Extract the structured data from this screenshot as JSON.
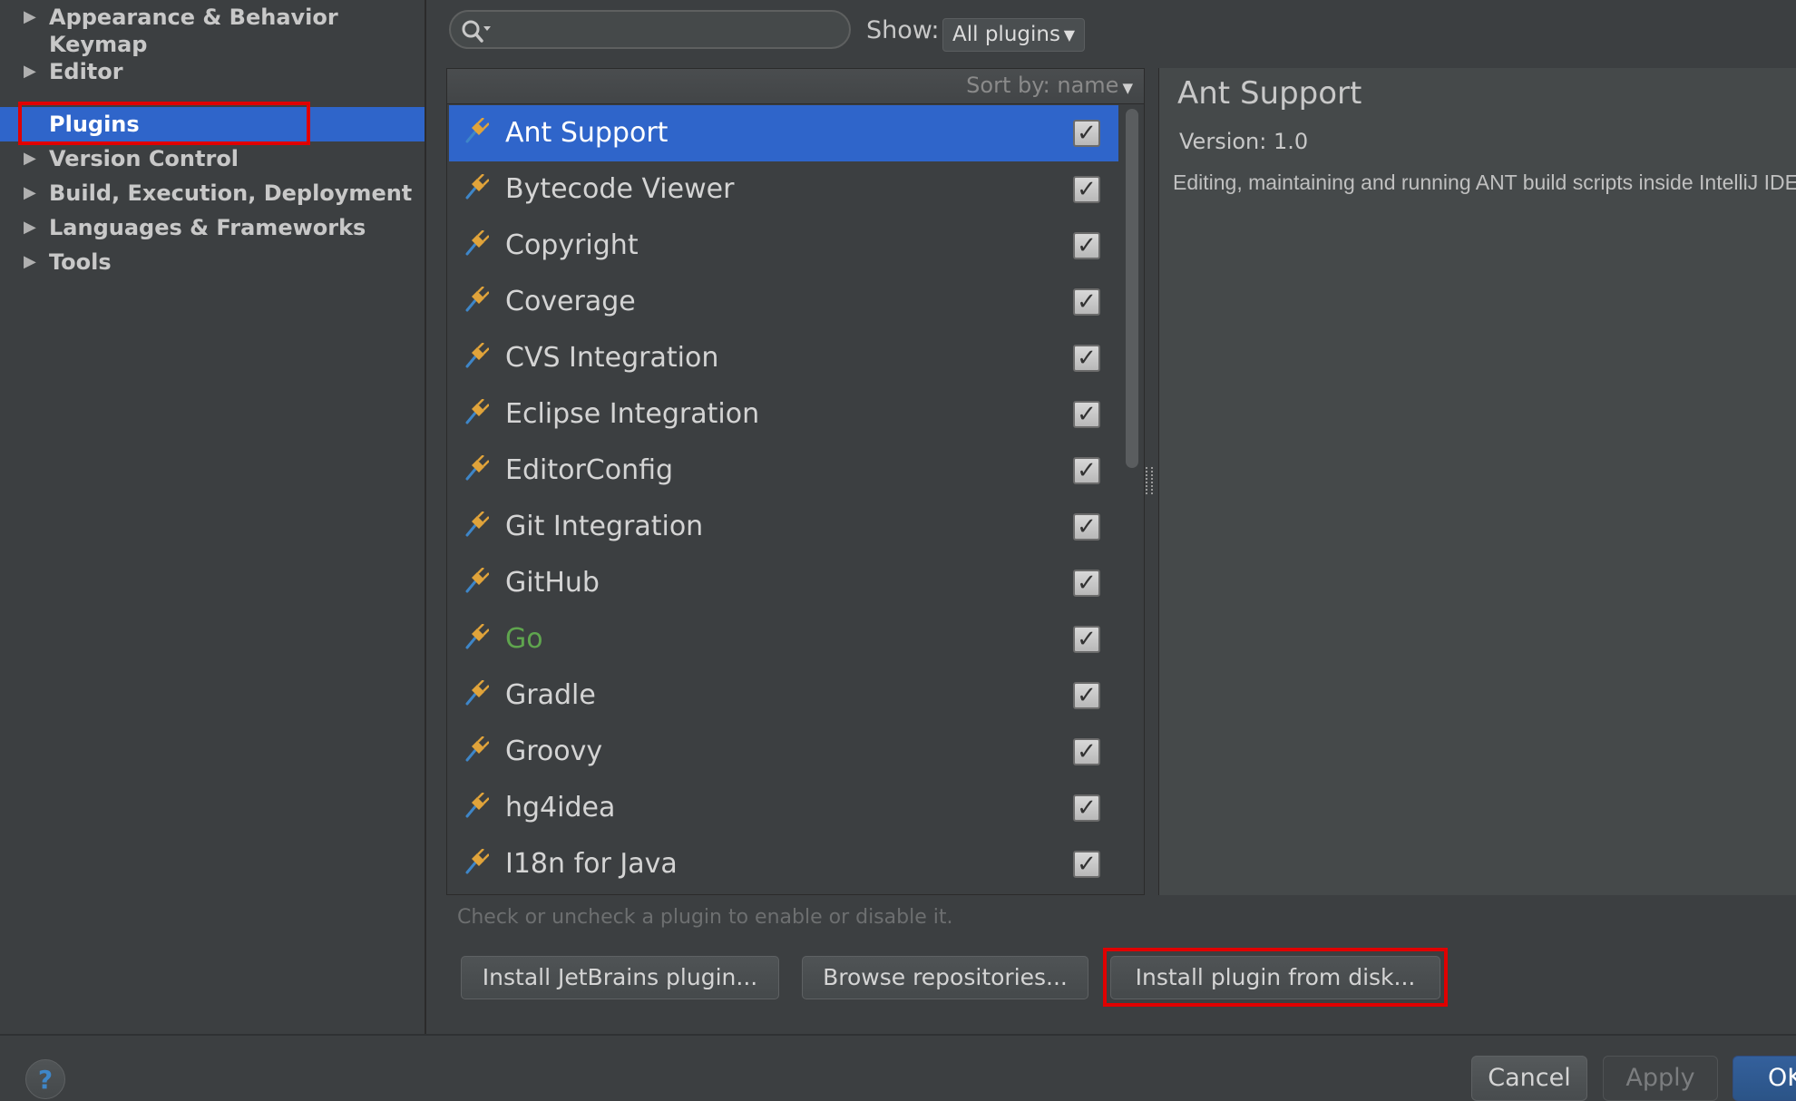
{
  "sidebar": {
    "items": [
      {
        "label": "Appearance & Behavior",
        "has_arrow": true,
        "selected": false
      },
      {
        "label": "Keymap",
        "has_arrow": false,
        "selected": false
      },
      {
        "label": "Editor",
        "has_arrow": true,
        "selected": false
      },
      {
        "label": "Plugins",
        "has_arrow": false,
        "selected": true
      },
      {
        "label": "Version Control",
        "has_arrow": true,
        "selected": false
      },
      {
        "label": "Build, Execution, Deployment",
        "has_arrow": true,
        "selected": false
      },
      {
        "label": "Languages & Frameworks",
        "has_arrow": true,
        "selected": false
      },
      {
        "label": "Tools",
        "has_arrow": true,
        "selected": false
      }
    ]
  },
  "toolbar": {
    "search": {
      "value": "",
      "placeholder": ""
    },
    "show_label": "Show:",
    "show_value": "All plugins"
  },
  "list": {
    "sort_label": "Sort by: name",
    "plugins": [
      {
        "name": "Ant Support",
        "checked": true,
        "selected": true,
        "color": "#ffffff"
      },
      {
        "name": "Bytecode Viewer",
        "checked": true,
        "selected": false
      },
      {
        "name": "Copyright",
        "checked": true,
        "selected": false
      },
      {
        "name": "Coverage",
        "checked": true,
        "selected": false
      },
      {
        "name": "CVS Integration",
        "checked": true,
        "selected": false
      },
      {
        "name": "Eclipse Integration",
        "checked": true,
        "selected": false
      },
      {
        "name": "EditorConfig",
        "checked": true,
        "selected": false
      },
      {
        "name": "Git Integration",
        "checked": true,
        "selected": false
      },
      {
        "name": "GitHub",
        "checked": true,
        "selected": false
      },
      {
        "name": "Go",
        "checked": true,
        "selected": false,
        "color": "#5fa54e"
      },
      {
        "name": "Gradle",
        "checked": true,
        "selected": false
      },
      {
        "name": "Groovy",
        "checked": true,
        "selected": false
      },
      {
        "name": "hg4idea",
        "checked": true,
        "selected": false
      },
      {
        "name": "I18n for Java",
        "checked": true,
        "selected": false
      }
    ]
  },
  "details": {
    "title": "Ant Support",
    "version": "Version: 1.0",
    "description": "Editing, maintaining and running ANT build scripts inside IntelliJ IDEA."
  },
  "hint": "Check or uncheck a plugin to enable or disable it.",
  "buttons": {
    "install_jetbrains": "Install JetBrains plugin...",
    "browse_repos": "Browse repositories...",
    "install_disk": "Install plugin from disk...",
    "help": "?",
    "cancel": "Cancel",
    "apply": "Apply",
    "ok": "OK"
  },
  "colors": {
    "selection": "#2f65ca",
    "highlight_border": "#e00000",
    "go_plugin_name": "#5fa54e"
  },
  "icons": {
    "search": "search-icon",
    "plugin": "plugin-icon",
    "checkbox": "check-mark-icon"
  }
}
